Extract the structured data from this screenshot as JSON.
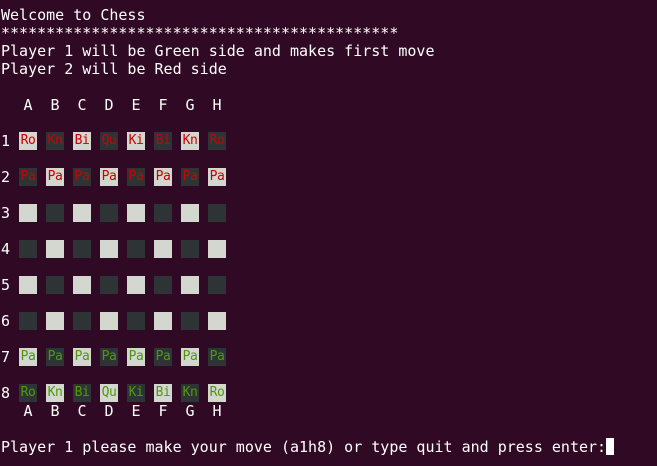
{
  "terminal": {
    "welcome": "Welcome to Chess",
    "separator": "********************************************",
    "player1_info": "Player 1 will be Green side and makes first move",
    "player2_info": "Player 2 will be Red side",
    "prompt": "Player 1 please make your move (a1h8) or type quit and press enter:"
  },
  "colors": {
    "background": "#300a24",
    "text": "#ffffff",
    "light_square": "#d3d7cf",
    "dark_square": "#2e3436",
    "red_piece": "#cc0000",
    "green_piece": "#4e9a06"
  },
  "board": {
    "columns": [
      "A",
      "B",
      "C",
      "D",
      "E",
      "F",
      "G",
      "H"
    ],
    "rows": [
      {
        "label": "1",
        "cells": [
          {
            "piece": "Ro",
            "side": "red",
            "shade": "light"
          },
          {
            "piece": "Kn",
            "side": "red",
            "shade": "dark"
          },
          {
            "piece": "Bi",
            "side": "red",
            "shade": "light"
          },
          {
            "piece": "Qu",
            "side": "red",
            "shade": "dark"
          },
          {
            "piece": "Ki",
            "side": "red",
            "shade": "light"
          },
          {
            "piece": "Bi",
            "side": "red",
            "shade": "dark"
          },
          {
            "piece": "Kn",
            "side": "red",
            "shade": "light"
          },
          {
            "piece": "Ro",
            "side": "red",
            "shade": "dark"
          }
        ]
      },
      {
        "label": "2",
        "cells": [
          {
            "piece": "Pa",
            "side": "red",
            "shade": "dark"
          },
          {
            "piece": "Pa",
            "side": "red",
            "shade": "light"
          },
          {
            "piece": "Pa",
            "side": "red",
            "shade": "dark"
          },
          {
            "piece": "Pa",
            "side": "red",
            "shade": "light"
          },
          {
            "piece": "Pa",
            "side": "red",
            "shade": "dark"
          },
          {
            "piece": "Pa",
            "side": "red",
            "shade": "light"
          },
          {
            "piece": "Pa",
            "side": "red",
            "shade": "dark"
          },
          {
            "piece": "Pa",
            "side": "red",
            "shade": "light"
          }
        ]
      },
      {
        "label": "3",
        "cells": [
          {
            "piece": "",
            "side": "",
            "shade": "light"
          },
          {
            "piece": "",
            "side": "",
            "shade": "dark"
          },
          {
            "piece": "",
            "side": "",
            "shade": "light"
          },
          {
            "piece": "",
            "side": "",
            "shade": "dark"
          },
          {
            "piece": "",
            "side": "",
            "shade": "light"
          },
          {
            "piece": "",
            "side": "",
            "shade": "dark"
          },
          {
            "piece": "",
            "side": "",
            "shade": "light"
          },
          {
            "piece": "",
            "side": "",
            "shade": "dark"
          }
        ]
      },
      {
        "label": "4",
        "cells": [
          {
            "piece": "",
            "side": "",
            "shade": "dark"
          },
          {
            "piece": "",
            "side": "",
            "shade": "light"
          },
          {
            "piece": "",
            "side": "",
            "shade": "dark"
          },
          {
            "piece": "",
            "side": "",
            "shade": "light"
          },
          {
            "piece": "",
            "side": "",
            "shade": "dark"
          },
          {
            "piece": "",
            "side": "",
            "shade": "light"
          },
          {
            "piece": "",
            "side": "",
            "shade": "dark"
          },
          {
            "piece": "",
            "side": "",
            "shade": "light"
          }
        ]
      },
      {
        "label": "5",
        "cells": [
          {
            "piece": "",
            "side": "",
            "shade": "light"
          },
          {
            "piece": "",
            "side": "",
            "shade": "dark"
          },
          {
            "piece": "",
            "side": "",
            "shade": "light"
          },
          {
            "piece": "",
            "side": "",
            "shade": "dark"
          },
          {
            "piece": "",
            "side": "",
            "shade": "light"
          },
          {
            "piece": "",
            "side": "",
            "shade": "dark"
          },
          {
            "piece": "",
            "side": "",
            "shade": "light"
          },
          {
            "piece": "",
            "side": "",
            "shade": "dark"
          }
        ]
      },
      {
        "label": "6",
        "cells": [
          {
            "piece": "",
            "side": "",
            "shade": "dark"
          },
          {
            "piece": "",
            "side": "",
            "shade": "light"
          },
          {
            "piece": "",
            "side": "",
            "shade": "dark"
          },
          {
            "piece": "",
            "side": "",
            "shade": "light"
          },
          {
            "piece": "",
            "side": "",
            "shade": "dark"
          },
          {
            "piece": "",
            "side": "",
            "shade": "light"
          },
          {
            "piece": "",
            "side": "",
            "shade": "dark"
          },
          {
            "piece": "",
            "side": "",
            "shade": "light"
          }
        ]
      },
      {
        "label": "7",
        "cells": [
          {
            "piece": "Pa",
            "side": "green",
            "shade": "light"
          },
          {
            "piece": "Pa",
            "side": "green",
            "shade": "dark"
          },
          {
            "piece": "Pa",
            "side": "green",
            "shade": "light"
          },
          {
            "piece": "Pa",
            "side": "green",
            "shade": "dark"
          },
          {
            "piece": "Pa",
            "side": "green",
            "shade": "light"
          },
          {
            "piece": "Pa",
            "side": "green",
            "shade": "dark"
          },
          {
            "piece": "Pa",
            "side": "green",
            "shade": "light"
          },
          {
            "piece": "Pa",
            "side": "green",
            "shade": "dark"
          }
        ]
      },
      {
        "label": "8",
        "cells": [
          {
            "piece": "Ro",
            "side": "green",
            "shade": "dark"
          },
          {
            "piece": "Kn",
            "side": "green",
            "shade": "light"
          },
          {
            "piece": "Bi",
            "side": "green",
            "shade": "dark"
          },
          {
            "piece": "Qu",
            "side": "green",
            "shade": "light"
          },
          {
            "piece": "Ki",
            "side": "green",
            "shade": "dark"
          },
          {
            "piece": "Bi",
            "side": "green",
            "shade": "light"
          },
          {
            "piece": "Kn",
            "side": "green",
            "shade": "dark"
          },
          {
            "piece": "Ro",
            "side": "green",
            "shade": "light"
          }
        ]
      }
    ]
  }
}
